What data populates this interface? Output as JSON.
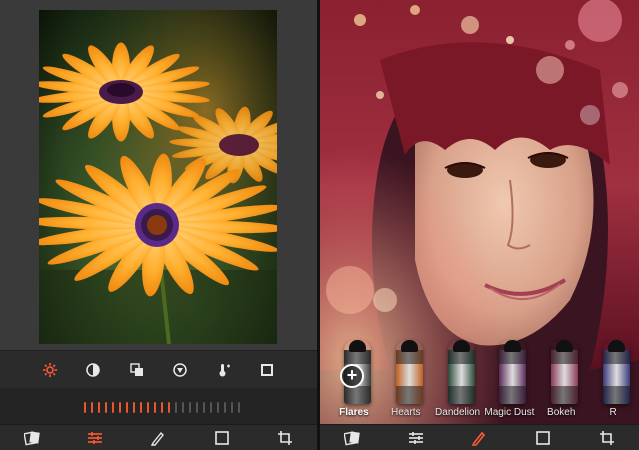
{
  "left_screen": {
    "tools": [
      {
        "name": "adjust-icon",
        "active": true
      },
      {
        "name": "contrast-icon",
        "active": false
      },
      {
        "name": "overlay-icon",
        "active": false
      },
      {
        "name": "vignette-icon",
        "active": false
      },
      {
        "name": "temperature-icon",
        "active": false
      },
      {
        "name": "frame-icon",
        "active": false
      }
    ],
    "slider": {
      "value": 0.5,
      "ticks": 23
    },
    "nav": [
      "filters-icon",
      "adjust-sliders-icon",
      "brush-icon",
      "frame-icon",
      "crop-icon"
    ],
    "active_nav": "adjust-sliders-icon"
  },
  "right_screen": {
    "effects": [
      {
        "label": "Flares",
        "selected": true
      },
      {
        "label": "Hearts",
        "selected": false
      },
      {
        "label": "Dandelion",
        "selected": false
      },
      {
        "label": "Magic Dust",
        "selected": false
      },
      {
        "label": "Bokeh",
        "selected": false
      },
      {
        "label": "R",
        "selected": false
      }
    ],
    "add_symbol": "+",
    "nav": [
      "filters-icon",
      "adjust-sliders-icon",
      "brush-icon",
      "frame-icon",
      "crop-icon"
    ],
    "active_nav": "brush-icon"
  },
  "colors": {
    "accent": "#ff5a36",
    "icon_inactive": "#e8e8e8",
    "tick_active": "#e8552f",
    "tick_inactive": "#555555"
  }
}
